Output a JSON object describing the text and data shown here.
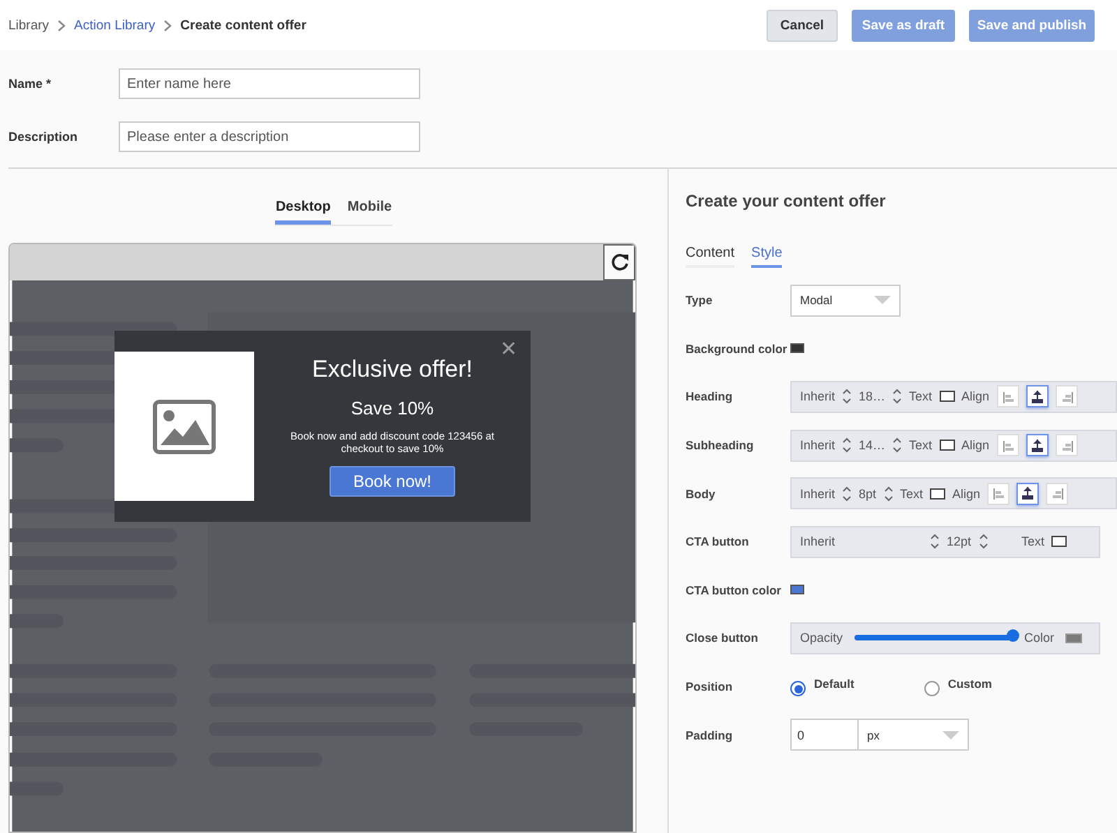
{
  "breadcrumb": [
    {
      "label": "Library",
      "kind": "plain"
    },
    {
      "label": "Action Library",
      "kind": "link"
    },
    {
      "label": "Create content offer",
      "kind": "current"
    }
  ],
  "actions": [
    {
      "label": "Cancel",
      "kind": "secondary"
    },
    {
      "label": "Save as draft",
      "kind": "primary"
    },
    {
      "label": "Save and publish",
      "kind": "primary"
    }
  ],
  "fields": [
    {
      "label": "Name *",
      "placeholder": "Enter name here"
    },
    {
      "label": "Description",
      "placeholder": "Please enter a description"
    }
  ],
  "preview_tabs": [
    {
      "label": "Desktop",
      "selected": true
    },
    {
      "label": "Mobile",
      "selected": false
    }
  ],
  "modal": {
    "heading": "Exclusive offer!",
    "subheading": "Save 10%",
    "body": "Book now and add discount code 123456 at checkout to save 10%",
    "cta": "Book now!",
    "close": "✕"
  },
  "panel": {
    "title": "Create your content offer",
    "tabs": [
      {
        "label": "Content",
        "selected": false
      },
      {
        "label": "Style",
        "selected": true
      }
    ],
    "rows": [
      {
        "kind": "select",
        "label": "Type",
        "value": "Modal"
      },
      {
        "kind": "color",
        "label": "Background color",
        "color": "#333333"
      },
      {
        "kind": "text_style",
        "label": "Heading",
        "font": "Inherit",
        "size": "18…",
        "text": "Text",
        "align": "Align",
        "aligns": [
          {
            "selected": false
          },
          {
            "selected": true
          },
          {
            "selected": false
          }
        ]
      },
      {
        "kind": "text_style",
        "label": "Subheading",
        "font": "Inherit",
        "size": "14…",
        "text": "Text",
        "align": "Align",
        "aligns": [
          {
            "selected": false
          },
          {
            "selected": true
          },
          {
            "selected": false
          }
        ]
      },
      {
        "kind": "text_style",
        "label": "Body",
        "font": "Inherit",
        "size": "8pt",
        "text": "Text",
        "align": "Align",
        "aligns": [
          {
            "selected": false
          },
          {
            "selected": true
          },
          {
            "selected": false
          }
        ]
      },
      {
        "kind": "cta_style",
        "label": "CTA button",
        "font": "Inherit",
        "size": "12pt",
        "text": "Text"
      },
      {
        "kind": "color",
        "label": "CTA button color",
        "color": "#4a77d4"
      },
      {
        "kind": "slider",
        "label": "Close button",
        "slider_label": "Opacity",
        "level": 1,
        "color_label": "Color",
        "color": "#7a7a7a"
      },
      {
        "kind": "radio",
        "label": "Position",
        "options": [
          {
            "label": "Default",
            "selected": true
          },
          {
            "label": "Custom",
            "selected": false
          }
        ]
      },
      {
        "kind": "padding",
        "label": "Padding",
        "value": "0",
        "unit": "px"
      }
    ]
  }
}
